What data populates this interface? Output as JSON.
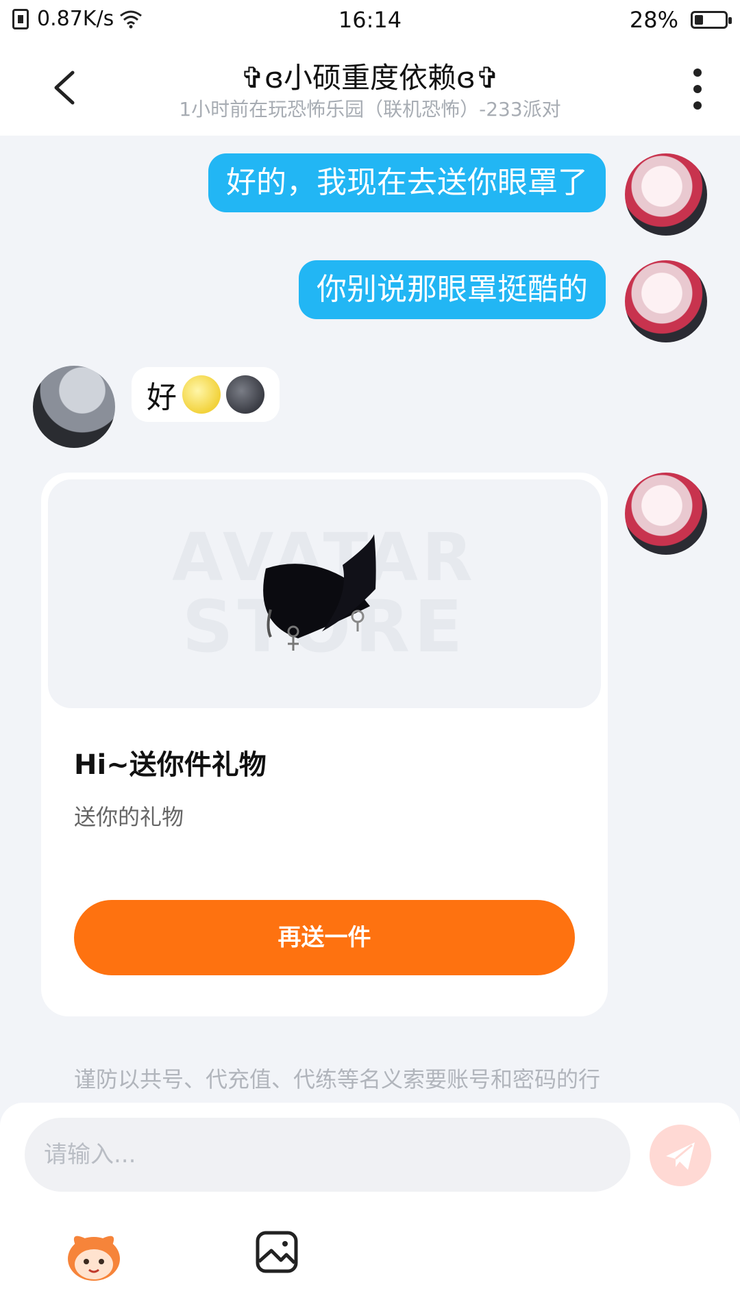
{
  "status_bar": {
    "network_speed": "0.87K/s",
    "time": "16:14",
    "battery_percent": "28%",
    "battery_level": 0.28
  },
  "header": {
    "title": "✞ɞ小硕重度依赖ɞ✞",
    "subtitle": "1小时前在玩恐怖乐园（联机恐怖）-233派对"
  },
  "messages": [
    {
      "side": "me",
      "text": "好的，我现在去送你眼罩了"
    },
    {
      "side": "me",
      "text": "你别说那眼罩挺酷的"
    },
    {
      "side": "other",
      "text": "好",
      "emojis": [
        "sun-face-emoji",
        "new-moon-face-emoji"
      ]
    }
  ],
  "gift_card": {
    "watermark_top": "AVATAR",
    "watermark_bottom": "STORE",
    "title": "Hi~送你件礼物",
    "description": "送你的礼物",
    "button_label": "再送一件"
  },
  "notice": "谨防以共号、代充值、代练等名义索要账号和密码的行",
  "input": {
    "placeholder": "请输入...",
    "value": ""
  },
  "colors": {
    "my_bubble": "#22b6f4",
    "action_button": "#fe7210",
    "background": "#f2f4f8"
  }
}
